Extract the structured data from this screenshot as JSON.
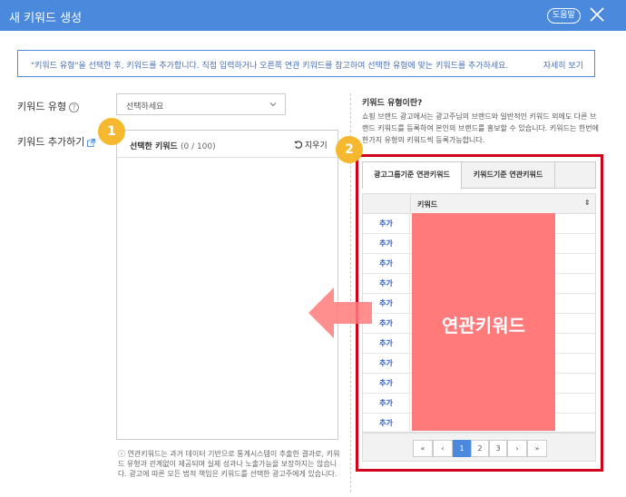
{
  "window": {
    "title": "새 키워드 생성",
    "help_label": "도움말"
  },
  "info": {
    "message": "\"키워드 유형\"을 선택한 후, 키워드를 추가합니다. 직접 입력하거나 오른쪽 연관 키워드를 참고하여 선택한 유형에 맞는 키워드를 추가하세요.",
    "more_link": "자세히 보기"
  },
  "form": {
    "type_label": "키워드 유형",
    "type_select_value": "선택하세요",
    "add_label": "키워드 추가하기",
    "selected_label": "선택한 키워드",
    "selected_count": "(0 / 100)",
    "clear_label": "지우기"
  },
  "note": "ⓘ 연관키워드는 과거 데이터 기반으로 통계시스템이 추출한 결과로, 키워드 유형과 관계없이 제공되며 실제 성과나 노출가능을 보장하지는 않습니다. 광고에 따른 모든 법적 책임은 키워드를 선택한 광고주에게 있습니다.",
  "right_panel": {
    "title": "키워드 유형이란?",
    "description": "쇼핑 브랜드 광고에서는 광고주님의 브랜드와 일반적인 키워드 외에도 다른 브랜드 키워드를 등록하여 본인의 브랜드를 홍보할 수 있습니다. 키워드는 한번에 한가지 유형의 키워드씩 등록가능합니다.",
    "tabs": [
      {
        "label": "광고그룹기준 연관키워드",
        "active": true
      },
      {
        "label": "키워드기준 연관키워드",
        "active": false
      }
    ],
    "table": {
      "keyword_header": "키워드",
      "rows": [
        {
          "action": "추가"
        },
        {
          "action": "추가"
        },
        {
          "action": "추가"
        },
        {
          "action": "추가"
        },
        {
          "action": "추가"
        },
        {
          "action": "추가"
        },
        {
          "action": "추가"
        },
        {
          "action": "추가"
        },
        {
          "action": "추가"
        },
        {
          "action": "추가"
        },
        {
          "action": "추가"
        }
      ]
    },
    "pagination": {
      "first": "«",
      "prev": "‹",
      "pages": [
        "1",
        "2",
        "3"
      ],
      "current": "1",
      "next": "›",
      "last": "»"
    }
  },
  "annotations": {
    "badge_1": "1",
    "badge_2": "2",
    "overlay_label": "연관키워드",
    "accent_color": "#4a89dc",
    "highlight_color": "#d0021b",
    "badge_color": "#f5b82e"
  }
}
